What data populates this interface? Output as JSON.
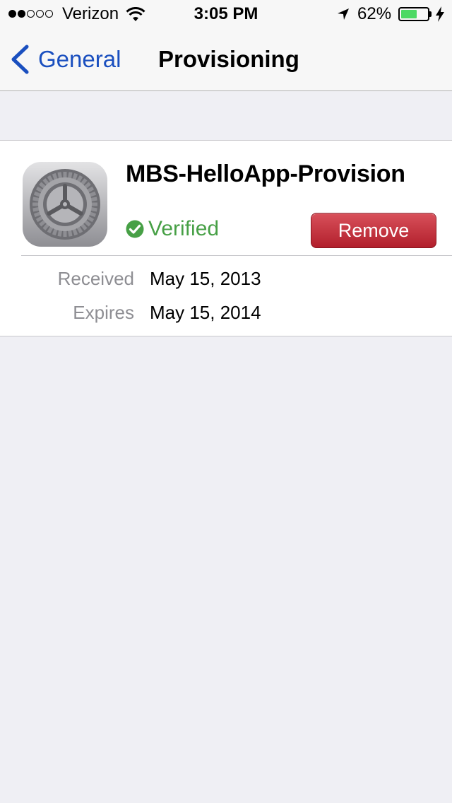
{
  "status_bar": {
    "signal_bars_filled": 2,
    "signal_bars_total": 5,
    "carrier": "Verizon",
    "wifi_icon": "wifi-icon",
    "time": "3:05 PM",
    "location_icon": "location-arrow-icon",
    "battery_percent": "62%",
    "battery_level": 0.62,
    "charging_icon": "charging-bolt-icon"
  },
  "navbar": {
    "back_label": "General",
    "title": "Provisioning"
  },
  "profile": {
    "icon": "settings-gear-icon",
    "name": "MBS-HelloApp-Provision",
    "status": "Verified",
    "status_color": "#47a046",
    "remove_label": "Remove",
    "remove_color": "#c0303c",
    "details": [
      {
        "label": "Received",
        "value": "May 15, 2013"
      },
      {
        "label": "Expires",
        "value": "May 15, 2014"
      }
    ]
  },
  "colors": {
    "accent": "#1a4fbf",
    "background": "#efeff4",
    "battery_fill": "#4cd964"
  }
}
